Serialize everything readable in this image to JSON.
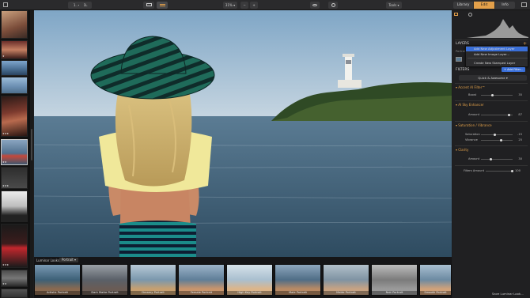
{
  "topbar": {
    "view_label": "1..",
    "zoom_small_label": "1L",
    "zoom_level": "31%",
    "zoom_out_label": "−",
    "zoom_in_label": "+",
    "tools_label": "Tools",
    "tabs": [
      {
        "label": "Library"
      },
      {
        "label": "Edit"
      },
      {
        "label": "Info"
      }
    ]
  },
  "filmstrip": {
    "thumbs": [
      {
        "stars": ""
      },
      {
        "stars": "★"
      },
      {
        "stars": ""
      },
      {
        "stars": ""
      },
      {
        "stars": "★★★"
      },
      {
        "stars": "★★"
      },
      {
        "stars": "★★★"
      },
      {
        "stars": ""
      },
      {
        "stars": "★★★"
      },
      {
        "stars": "★★"
      },
      {
        "stars": ""
      }
    ]
  },
  "looks": {
    "title": "Luminar Looks",
    "category": "Portrait",
    "save_label": "Save Luminar Look...",
    "items": [
      {
        "label": "Artistic Portrait"
      },
      {
        "label": "Dark Matte Portrait"
      },
      {
        "label": "Dreamy Portrait"
      },
      {
        "label": "Female Portrait"
      },
      {
        "label": "High Key Portrait"
      },
      {
        "label": "Male Portrait"
      },
      {
        "label": "Matte Portrait"
      },
      {
        "label": "Noir Portrait"
      },
      {
        "label": "Smooth Portrait"
      }
    ]
  },
  "panel": {
    "layers_title": "LAYERS",
    "layer_name": "Portrait...",
    "menu_items": [
      {
        "label": "Add New Adjustment Layer"
      },
      {
        "label": "Add New Image Layer..."
      },
      {
        "label": "Create New Stamped Layer"
      }
    ],
    "filters_title": "FILTERS",
    "add_filter_label": "+ Add Filter...",
    "preset_label": "Quick & Awesome",
    "sections": [
      {
        "title": "Accent AI Filter™",
        "sliders": [
          {
            "label": "Boost",
            "value": "35",
            "fraction": 0.35
          }
        ]
      },
      {
        "title": "AI Sky Enhancer",
        "sliders": [
          {
            "label": "Amount",
            "value": "87",
            "fraction": 0.87
          }
        ]
      },
      {
        "title": "Saturation / Vibrance",
        "sliders": [
          {
            "label": "Saturation",
            "value": "-15",
            "fraction": 0.43
          },
          {
            "label": "Vibrance",
            "value": "25",
            "fraction": 0.62
          }
        ]
      },
      {
        "title": "Clarity",
        "sliders": [
          {
            "label": "Amount",
            "value": "30",
            "fraction": 0.3
          }
        ]
      }
    ],
    "filters_amount_label": "Filters Amount",
    "filters_amount_value": "100",
    "filters_amount_fraction": 1.0
  }
}
